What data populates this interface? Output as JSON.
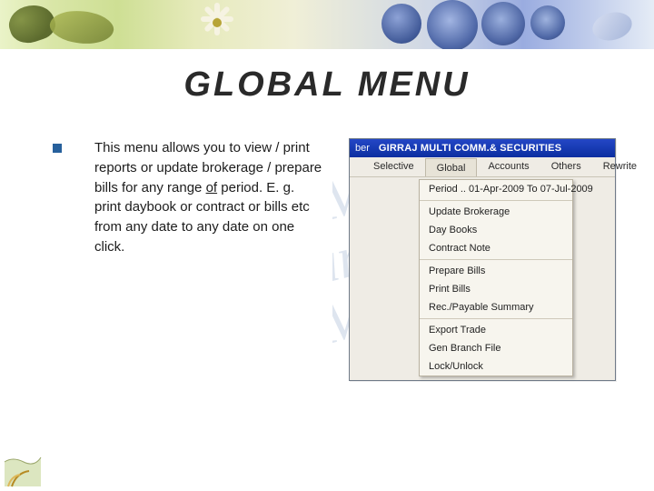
{
  "slide": {
    "title": "GLOBAL MENU",
    "bullet_text_pre": "This menu allows you to view / print reports or update brokerage / prepare bills for any range ",
    "bullet_text_underlined": "of",
    "bullet_text_post": " period. E. g. print daybook or contract or bills etc from any date to any date on one click."
  },
  "app": {
    "titlebar_left": "ber",
    "titlebar_name": "GIRRAJ MULTI COMM.& SECURITIES",
    "menubar": [
      "Selective",
      "Global",
      "Accounts",
      "Others",
      "Rewrite"
    ],
    "menubar_selected_index": 1,
    "dropdown": {
      "period_label": "Period .. 01-Apr-2009 To 07-Jul-2009",
      "groups": [
        [
          "Update Brokerage",
          "Day Books",
          "Contract Note"
        ],
        [
          "Prepare Bills",
          "Print Bills",
          "Rec./Payable Summary"
        ],
        [
          "Export Trade",
          "Gen Branch File",
          "Lock/Unlock"
        ]
      ]
    }
  },
  "watermark_lines": [
    "m  Man",
    "alam  M",
    "m  Mang"
  ]
}
